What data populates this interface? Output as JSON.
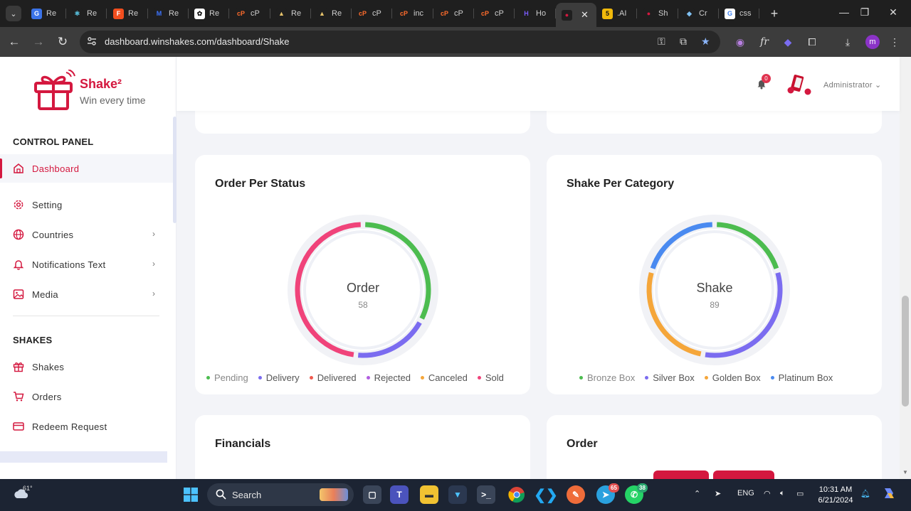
{
  "browser": {
    "tabs": [
      {
        "label": "Re",
        "fav": "G",
        "color": "#3b73e8"
      },
      {
        "label": "Re",
        "fav": "⚛",
        "color": "#1f1f1f",
        "fg": "#61dafb"
      },
      {
        "label": "Re",
        "fav": "F",
        "color": "#f24e1e"
      },
      {
        "label": "Re",
        "fav": "M",
        "color": "#1f1f1f",
        "fg": "#3d74ff"
      },
      {
        "label": "Re",
        "fav": "✿",
        "color": "#ffffff",
        "fg": "#111"
      },
      {
        "label": "cP",
        "fav": "cP",
        "color": "#1f1f1f",
        "fg": "#ff6c2c"
      },
      {
        "label": "Re",
        "fav": "▲",
        "color": "#1f1f1f",
        "fg": "#e6c36b"
      },
      {
        "label": "Re",
        "fav": "▲",
        "color": "#1f1f1f",
        "fg": "#e6c36b"
      },
      {
        "label": "cP",
        "fav": "cP",
        "color": "#1f1f1f",
        "fg": "#ff6c2c"
      },
      {
        "label": "inc",
        "fav": "cP",
        "color": "#1f1f1f",
        "fg": "#ff6c2c"
      },
      {
        "label": "cP",
        "fav": "cP",
        "color": "#1f1f1f",
        "fg": "#ff6c2c"
      },
      {
        "label": "cP",
        "fav": "cP",
        "color": "#1f1f1f",
        "fg": "#ff6c2c"
      },
      {
        "label": "Ho",
        "fav": "H",
        "color": "#1f1f1f",
        "fg": "#7b5cff"
      },
      {
        "label": "",
        "fav": "●",
        "color": "#1f1f1f",
        "fg": "#d4183f",
        "active": true
      },
      {
        "label": ".AI",
        "fav": "5",
        "color": "#f0b90b",
        "fg": "#111"
      },
      {
        "label": "Sh",
        "fav": "●",
        "color": "#1f1f1f",
        "fg": "#d4183f"
      },
      {
        "label": "Cr",
        "fav": "◆",
        "color": "#1f1f1f",
        "fg": "#7fc1f2"
      },
      {
        "label": "css",
        "fav": "G",
        "color": "#ffffff",
        "fg": "#4285f4"
      }
    ],
    "url": "dashboard.winshakes.com/dashboard/Shake",
    "profile_initial": "m"
  },
  "brand": {
    "name": "Shake²",
    "tagline": "Win every time"
  },
  "sidebar": {
    "control_title": "CONTROL PANEL",
    "control_items": [
      {
        "label": "Dashboard",
        "icon": "home-icon"
      },
      {
        "label": "Setting",
        "icon": "gear-icon"
      },
      {
        "label": "Countries",
        "icon": "globe-icon"
      },
      {
        "label": "Notifications Text",
        "icon": "bell-icon"
      },
      {
        "label": "Media",
        "icon": "image-icon"
      }
    ],
    "shakes_title": "SHAKES",
    "shakes_items": [
      {
        "label": "Shakes",
        "icon": "gift-icon"
      },
      {
        "label": "Orders",
        "icon": "cart-icon"
      },
      {
        "label": "Redeem Request",
        "icon": "card-icon"
      }
    ]
  },
  "header": {
    "notification_count": "0",
    "user": "Administrator"
  },
  "cards": {
    "order_status": {
      "title": "Order Per Status",
      "center_label": "Order",
      "center_value": "58",
      "legend": [
        {
          "label": "Pending",
          "color": "#4cbc4f"
        },
        {
          "label": "Delivery",
          "color": "#7b6cf0"
        },
        {
          "label": "Delivered",
          "color": "#f05a4f"
        },
        {
          "label": "Rejected",
          "color": "#b15ee0"
        },
        {
          "label": "Canceled",
          "color": "#f5a63a"
        },
        {
          "label": "Sold",
          "color": "#f0437a"
        }
      ]
    },
    "shake_category": {
      "title": "Shake Per Category",
      "center_label": "Shake",
      "center_value": "89",
      "legend": [
        {
          "label": "Bronze Box",
          "color": "#4cbc4f"
        },
        {
          "label": "Silver Box",
          "color": "#7b6cf0"
        },
        {
          "label": "Golden Box",
          "color": "#f5a63a"
        },
        {
          "label": "Platinum Box",
          "color": "#4a8af0"
        }
      ]
    },
    "financials": {
      "title": "Financials"
    },
    "order": {
      "title": "Order"
    }
  },
  "chart_data": [
    {
      "type": "pie",
      "title": "Order Per Status",
      "center_label": "Order",
      "total": 58,
      "categories": [
        "Pending",
        "Delivery",
        "Delivered",
        "Rejected",
        "Canceled",
        "Sold"
      ],
      "values": [
        19,
        11,
        0,
        0,
        0,
        28
      ],
      "colors": [
        "#4cbc4f",
        "#7b6cf0",
        "#f05a4f",
        "#b15ee0",
        "#f5a63a",
        "#f0437a"
      ]
    },
    {
      "type": "pie",
      "title": "Shake Per Category",
      "center_label": "Shake",
      "total": 89,
      "categories": [
        "Bronze Box",
        "Silver Box",
        "Golden Box",
        "Platinum Box"
      ],
      "values": [
        18,
        29,
        24,
        18
      ],
      "colors": [
        "#4cbc4f",
        "#7b6cf0",
        "#f5a63a",
        "#4a8af0"
      ]
    }
  ],
  "taskbar": {
    "temperature": "61°",
    "search_placeholder": "Search",
    "language": "ENG",
    "time": "10:31 AM",
    "date": "6/21/2024",
    "telegram_badge": "65",
    "whatsapp_badge": "38"
  }
}
